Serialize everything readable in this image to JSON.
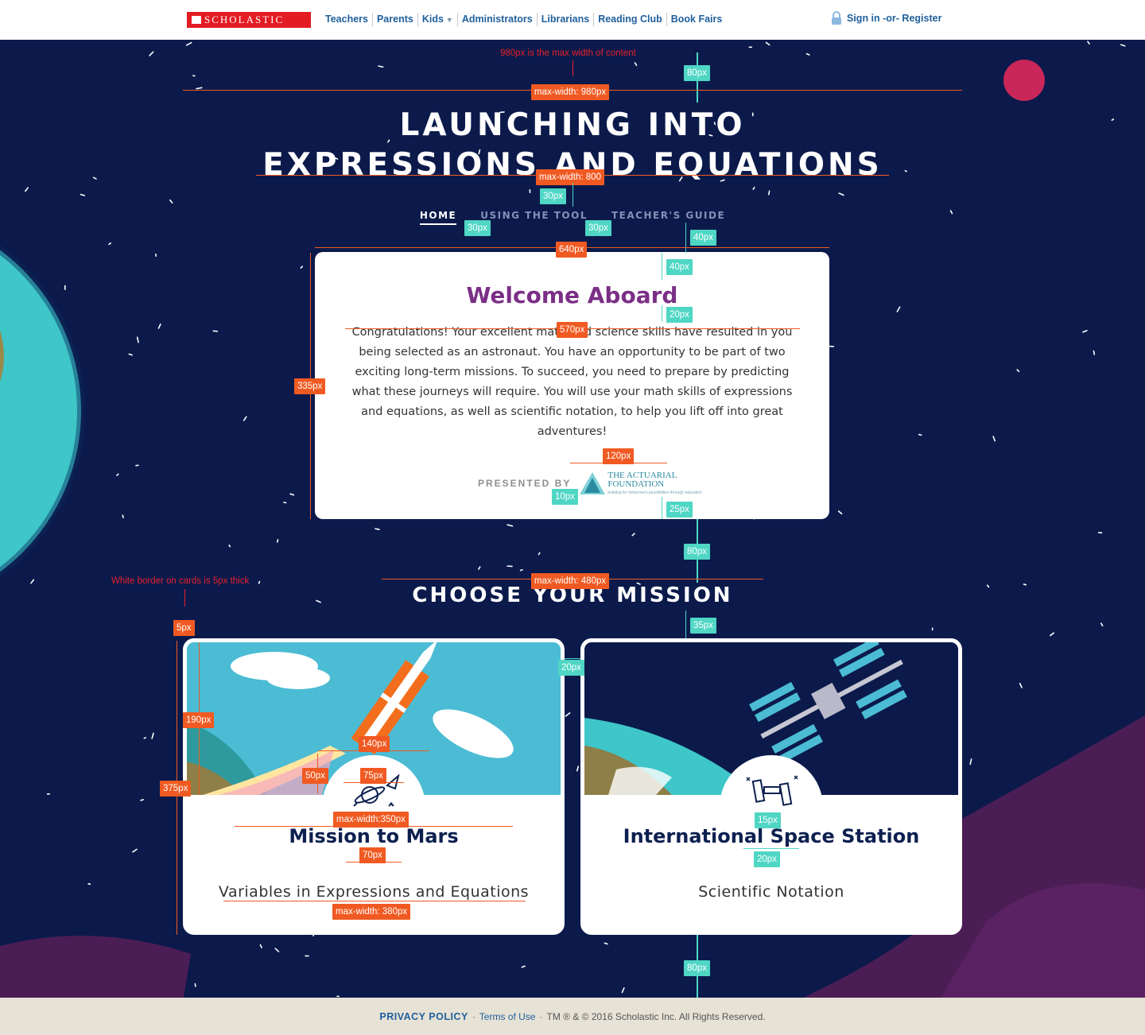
{
  "header": {
    "logo_text": "SCHOLASTIC",
    "nav": [
      "Teachers",
      "Parents",
      "Kids",
      "Administrators",
      "Librarians",
      "Reading Club",
      "Book Fairs"
    ],
    "signin": "Sign in -or- Register"
  },
  "hero": {
    "title_line1": "LAUNCHING INTO",
    "title_line2": "EXPRESSIONS AND EQUATIONS"
  },
  "subnav": [
    "HOME",
    "USING THE TOOL",
    "TEACHER'S GUIDE"
  ],
  "welcome": {
    "title": "Welcome Aboard",
    "body": "Congratulations! Your excellent math and science skills have resulted in you being selected as an astronaut. You have an opportunity to be part of two exciting long-term missions. To succeed, you need to prepare by predicting what these journeys will require. You will use your math skills of expressions and equations, as well as scientific notation, to help you lift off into great adventures!",
    "presented_by": "PRESENTED BY",
    "sponsor_line1": "THE ACTUARIAL",
    "sponsor_line2": "FOUNDATION",
    "sponsor_tagline": "building for tomorrow's possibilities through education"
  },
  "missions": {
    "heading": "CHOOSE YOUR MISSION",
    "cards": [
      {
        "title": "Mission to Mars",
        "subtitle": "Variables in Expressions and Equations",
        "icon": "rocket-planet-icon"
      },
      {
        "title": "International Space Station",
        "subtitle": "Scientific Notation",
        "icon": "space-station-icon"
      }
    ]
  },
  "footer": {
    "privacy": "PRIVACY POLICY",
    "terms": "Terms of Use",
    "copyright": "TM ® & © 2016 Scholastic Inc. All Rights Reserved."
  },
  "annotations": {
    "note_maxwidth": "980px is the max width of content",
    "note_border": "White border on cards is 5px thick",
    "orange": [
      "max-width: 980px",
      "max-width: 800",
      "640px",
      "570px",
      "335px",
      "120px",
      "max-width: 480px",
      "5px",
      "190px",
      "375px",
      "140px",
      "50px",
      "75px",
      "max-width:350px",
      "70px",
      "max-width: 380px"
    ],
    "teal": [
      "80px",
      "30px",
      "30px",
      "30px",
      "40px",
      "40px",
      "20px",
      "10px",
      "25px",
      "80px",
      "35px",
      "20px",
      "15px",
      "20px",
      "80px"
    ]
  },
  "colors": {
    "space": "#0b1a4b",
    "welcome_title": "#7b2f86",
    "mission_title": "#0d2050",
    "annotation_orange": "#f05a22",
    "annotation_teal": "#4fd6c4",
    "scholastic_red": "#e31b23",
    "link_blue": "#1f5f9c"
  }
}
